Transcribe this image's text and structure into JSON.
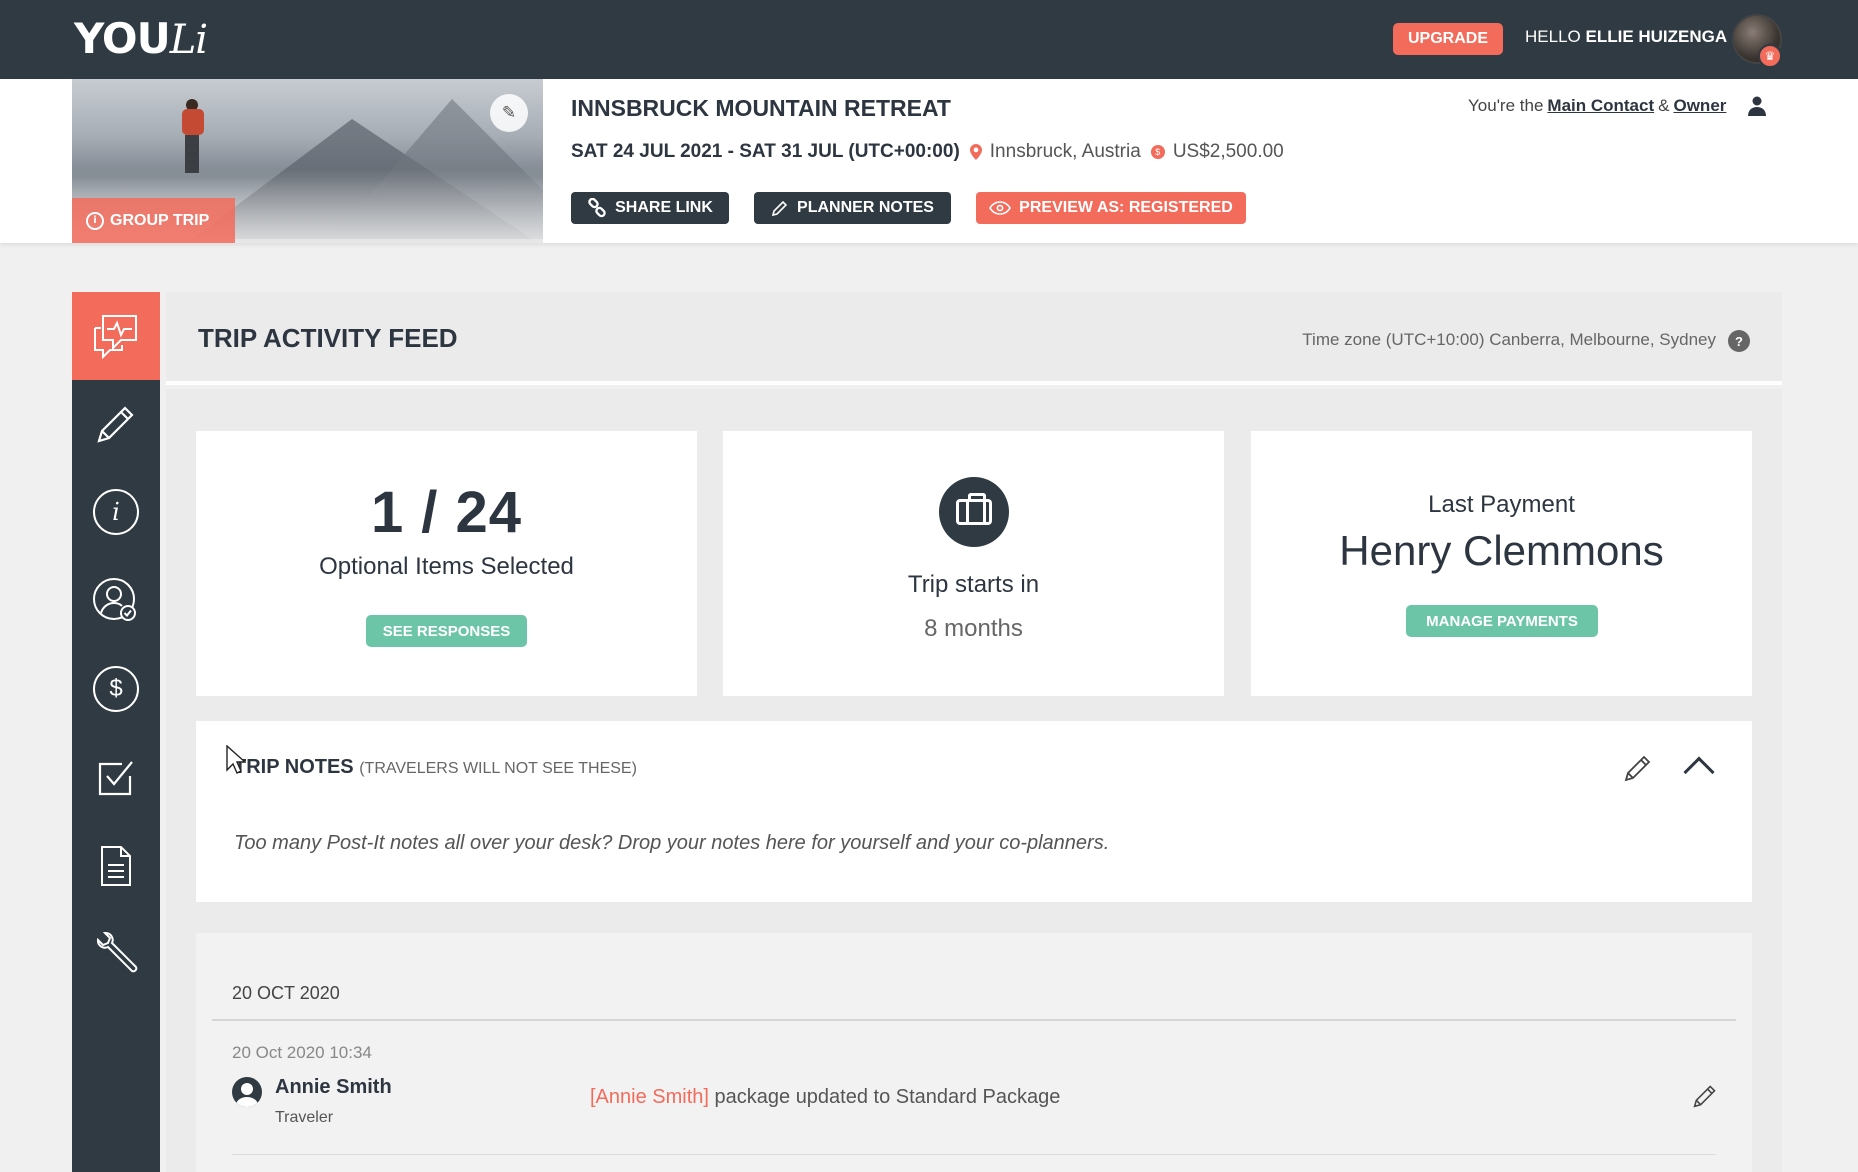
{
  "topbar": {
    "logo_you": "YOU",
    "logo_li": "Li",
    "upgrade_label": "UPGRADE",
    "hello_prefix": "HELLO",
    "user_name": "ELLIE HUIZENGA"
  },
  "trip": {
    "group_tag": "GROUP TRIP",
    "title": "INNSBRUCK MOUNTAIN RETREAT",
    "dates": "SAT 24 JUL 2021 - SAT 31 JUL (UTC+00:00)",
    "location": "Innsbruck, Austria",
    "price": "US$2,500.00",
    "buttons": {
      "share": "SHARE LINK",
      "planner_notes": "PLANNER NOTES",
      "preview": "PREVIEW AS: REGISTERED"
    },
    "contact_prefix": "You're the",
    "contact_role1": "Main Contact",
    "contact_amp": "&",
    "contact_role2": "Owner"
  },
  "feed_header": {
    "title": "TRIP ACTIVITY FEED",
    "timezone": "Time zone (UTC+10:00) Canberra, Melbourne, Sydney",
    "help": "?"
  },
  "cards": {
    "optional": {
      "count": "1 / 24",
      "label": "Optional Items Selected",
      "button": "SEE RESPONSES"
    },
    "countdown": {
      "label": "Trip starts in",
      "value": "8 months"
    },
    "payment": {
      "label": "Last Payment",
      "name": "Henry Clemmons",
      "button": "MANAGE PAYMENTS"
    }
  },
  "notes": {
    "title": "TRIP NOTES",
    "subtitle": "(TRAVELERS WILL NOT SEE THESE)",
    "text": "Too many Post-It notes all over your desk? Drop your notes here for yourself and your co-planners."
  },
  "feed": {
    "date_heading": "20 OCT 2020",
    "entries": [
      {
        "timestamp": "20 Oct 2020 10:34",
        "name": "Annie Smith",
        "role": "Traveler",
        "actor": "[Annie Smith]",
        "message": "package updated to Standard Package"
      }
    ]
  },
  "colors": {
    "dark": "#2f3a42",
    "coral": "#f26b5b",
    "green": "#6cc5a7",
    "background": "#f0f0f0"
  },
  "icons": {
    "sidebar": [
      "activity-feed-icon",
      "pencil-icon",
      "info-icon",
      "travelers-icon",
      "dollar-icon",
      "checklist-icon",
      "document-icon",
      "wrench-icon"
    ]
  }
}
